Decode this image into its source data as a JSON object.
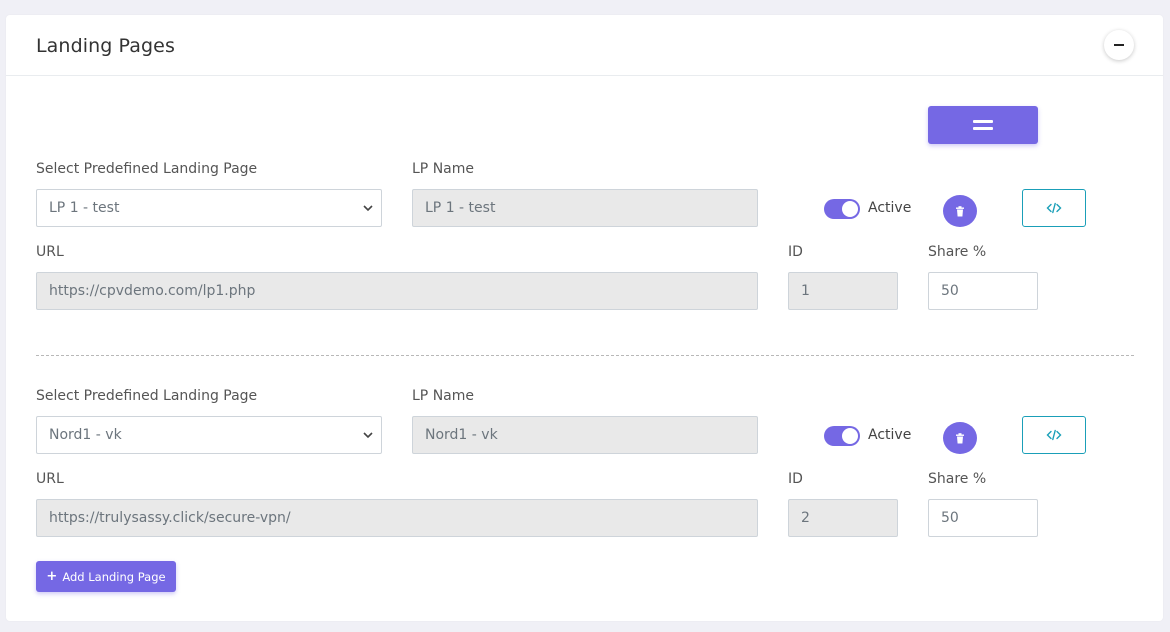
{
  "card": {
    "title": "Landing Pages",
    "collapse_icon": "minus-icon",
    "drag_icon": "drag-handle-icon"
  },
  "landing_pages": [
    {
      "predefined_label": "Select Predefined Landing Page",
      "predefined_value": "LP 1 - test",
      "name_label": "LP Name",
      "name_value": "LP 1 - test",
      "active_label": "Active",
      "active": true,
      "url_label": "URL",
      "url_value": "https://cpvdemo.com/lp1.php",
      "id_label": "ID",
      "id_value": "1",
      "share_label": "Share %",
      "share_value": "50",
      "delete_icon": "trash-icon",
      "code_icon": "code-icon"
    },
    {
      "predefined_label": "Select Predefined Landing Page",
      "predefined_value": "Nord1 - vk",
      "name_label": "LP Name",
      "name_value": "Nord1 - vk",
      "active_label": "Active",
      "active": true,
      "url_label": "URL",
      "url_value": "https://trulysassy.click/secure-vpn/",
      "id_label": "ID",
      "id_value": "2",
      "share_label": "Share %",
      "share_value": "50",
      "delete_icon": "trash-icon",
      "code_icon": "code-icon"
    }
  ],
  "add_button": {
    "icon": "plus-icon",
    "label": "Add Landing Page"
  },
  "colors": {
    "accent": "#7568e4",
    "code_button_border": "#1a9fb8",
    "readonly_bg": "#e9e9e9"
  }
}
